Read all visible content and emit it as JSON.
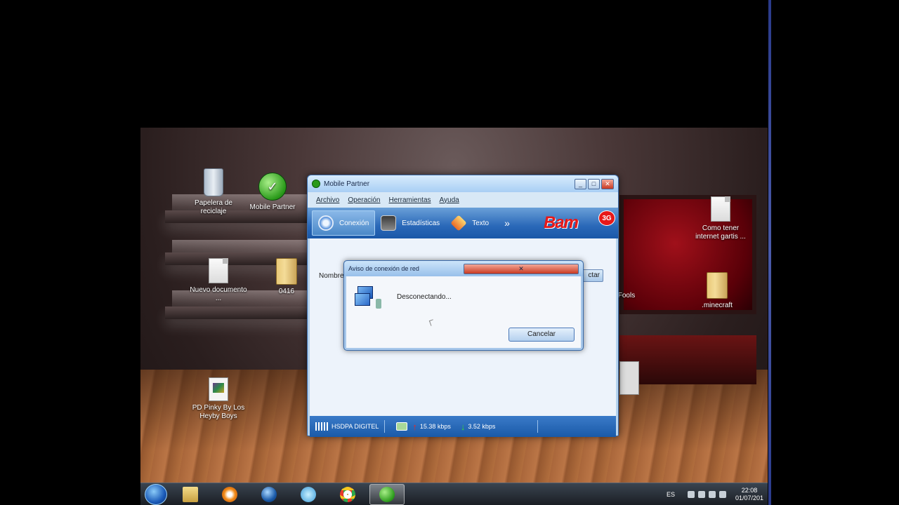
{
  "desktop": {
    "icons": [
      {
        "name": "Papelera de reciclaje"
      },
      {
        "name": "Mobile Partner"
      },
      {
        "name": "Nuevo documento ..."
      },
      {
        "name": "0416"
      },
      {
        "name": "PD Pinky By Los Heyby Boys"
      },
      {
        "name": "Como tener internet gartis ..."
      },
      {
        "name": ".minecraft"
      },
      {
        "name": "Fools"
      }
    ]
  },
  "mobile_partner": {
    "title": "Mobile Partner",
    "menu": [
      "Archivo",
      "Operación",
      "Herramientas",
      "Ayuda"
    ],
    "toolbar": {
      "items": [
        {
          "label": "Conexión",
          "icon": "connection-icon"
        },
        {
          "label": "Estadísticas",
          "icon": "statistics-icon"
        },
        {
          "label": "Texto",
          "icon": "sms-icon"
        }
      ],
      "more": "»",
      "brand": "Bam",
      "brand_badge": "3G"
    },
    "body": {
      "name_label": "Nombre",
      "connect_button_partial": "ctar"
    },
    "status": {
      "network": "HSDPA DIGITEL",
      "upload": "15.38 kbps",
      "download": "3.52 kbps"
    }
  },
  "dialog": {
    "title": "Aviso de conexión de red",
    "message": "Desconectando...",
    "cancel_label": "Cancelar"
  },
  "taskbar": {
    "tray": {
      "language": "ES",
      "time": "22:08",
      "date": "01/07/201"
    }
  }
}
